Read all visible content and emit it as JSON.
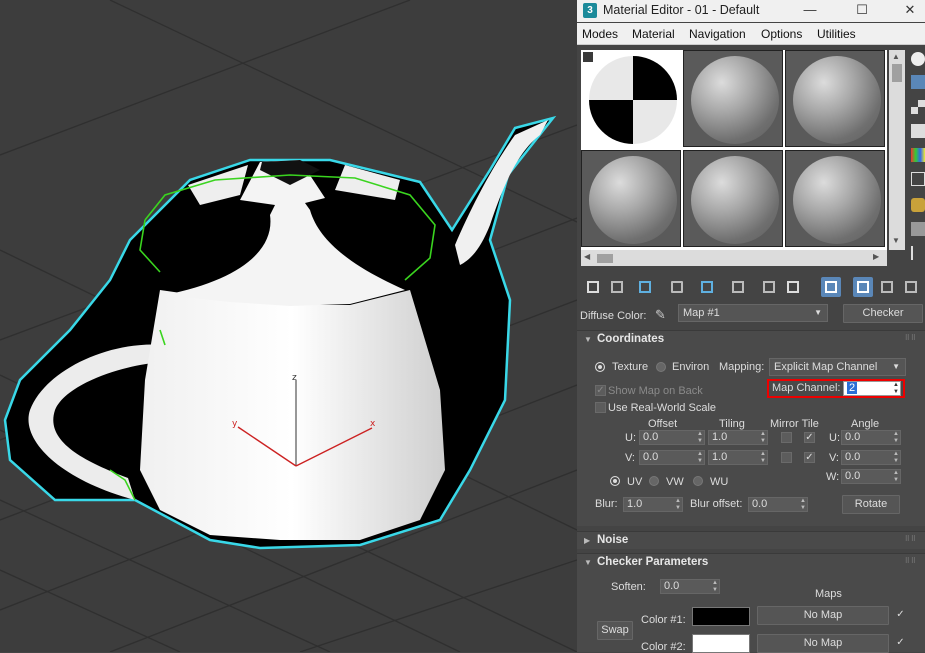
{
  "window": {
    "title": "Material Editor - 01 - Default",
    "app_icon": "3",
    "minimize": "—",
    "maximize": "☐",
    "close": "✕"
  },
  "menu": [
    "Modes",
    "Material",
    "Navigation",
    "Options",
    "Utilities"
  ],
  "viewport": {
    "axis_z": "z",
    "axis_x": "x",
    "axis_y": "y",
    "accent_outline": "#39d8e8",
    "selection_green": "#3ad41f"
  },
  "diffuse": {
    "label": "Diffuse Color:",
    "map_name": "Map #1",
    "type_button": "Checker"
  },
  "coordinates": {
    "header": "Coordinates",
    "texture_label": "Texture",
    "environ_label": "Environ",
    "mapping_label": "Mapping:",
    "mapping_value": "Explicit Map Channel",
    "map_channel_label": "Map Channel:",
    "map_channel_value": "2",
    "show_map_on_back": "Show Map on Back",
    "use_real_world": "Use Real-World Scale",
    "col_offset": "Offset",
    "col_tiling": "Tiling",
    "col_mirror_tile": "Mirror Tile",
    "col_angle": "Angle",
    "u_label": "U:",
    "v_label": "V:",
    "w_label": "W:",
    "u_offset": "0.0",
    "v_offset": "0.0",
    "u_tiling": "1.0",
    "v_tiling": "1.0",
    "u_angle": "0.0",
    "v_angle": "0.0",
    "w_angle": "0.0",
    "uv": "UV",
    "vw": "VW",
    "wu": "WU",
    "blur_label": "Blur:",
    "blur_value": "1.0",
    "blur_offset_label": "Blur offset:",
    "blur_offset_value": "0.0",
    "rotate_button": "Rotate"
  },
  "noise": {
    "header": "Noise"
  },
  "checker": {
    "header": "Checker Parameters",
    "soften_label": "Soften:",
    "soften_value": "0.0",
    "maps_label": "Maps",
    "color1_label": "Color #1:",
    "color1": "#000000",
    "color2_label": "Color #2:",
    "color2": "#ffffff",
    "no_map_1": "No Map",
    "no_map_2": "No Map",
    "swap_button": "Swap"
  },
  "grip": "⠿⠿"
}
